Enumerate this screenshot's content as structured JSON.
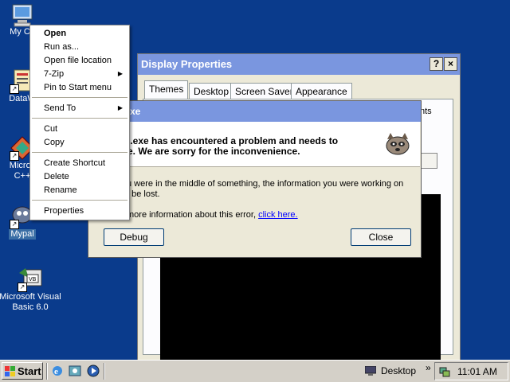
{
  "desktop": {
    "icons": [
      {
        "label": "My Co"
      },
      {
        "label": "DataW"
      },
      {
        "label": "Micros",
        "label2": "C++"
      },
      {
        "label": "Mypal"
      },
      {
        "label": "Microsoft Visual",
        "label2": "Basic 6.0"
      }
    ]
  },
  "context_menu": {
    "items": [
      {
        "label": "Open"
      },
      {
        "label": "Run as..."
      },
      {
        "label": "Open file location"
      },
      {
        "label": "7-Zip"
      },
      {
        "label": "Pin to Start menu"
      },
      {
        "label": "Send To"
      },
      {
        "label": "Cut"
      },
      {
        "label": "Copy"
      },
      {
        "label": "Create Shortcut"
      },
      {
        "label": "Delete"
      },
      {
        "label": "Rename"
      },
      {
        "label": "Properties"
      }
    ]
  },
  "display_properties": {
    "title": "Display Properties",
    "help_btn": "?",
    "close_btn": "×",
    "tabs": [
      "Themes",
      "Desktop",
      "Screen Saver",
      "Appearance"
    ],
    "partial_text": "nts"
  },
  "error_dialog": {
    "title": "xe",
    "headline1": "l.exe has encountered a problem and needs to",
    "headline2": "e.  We are sorry for the inconvenience.",
    "body1": "u were in the middle of something, the information you were working on",
    "body2": "t be lost.",
    "more_prefix": "more information about this error,",
    "more_link": "click here.",
    "debug_label": "Debug",
    "close_label": "Close"
  },
  "taskbar": {
    "start_label": "Start",
    "desktop_label": "Desktop",
    "chevron": "»",
    "clock": "11:01 AM"
  },
  "colors": {
    "desktop_bg": "#0a3b8c",
    "active_title": "#0a246a",
    "inactive_title": "#7a96df",
    "link": "#0000ff"
  }
}
